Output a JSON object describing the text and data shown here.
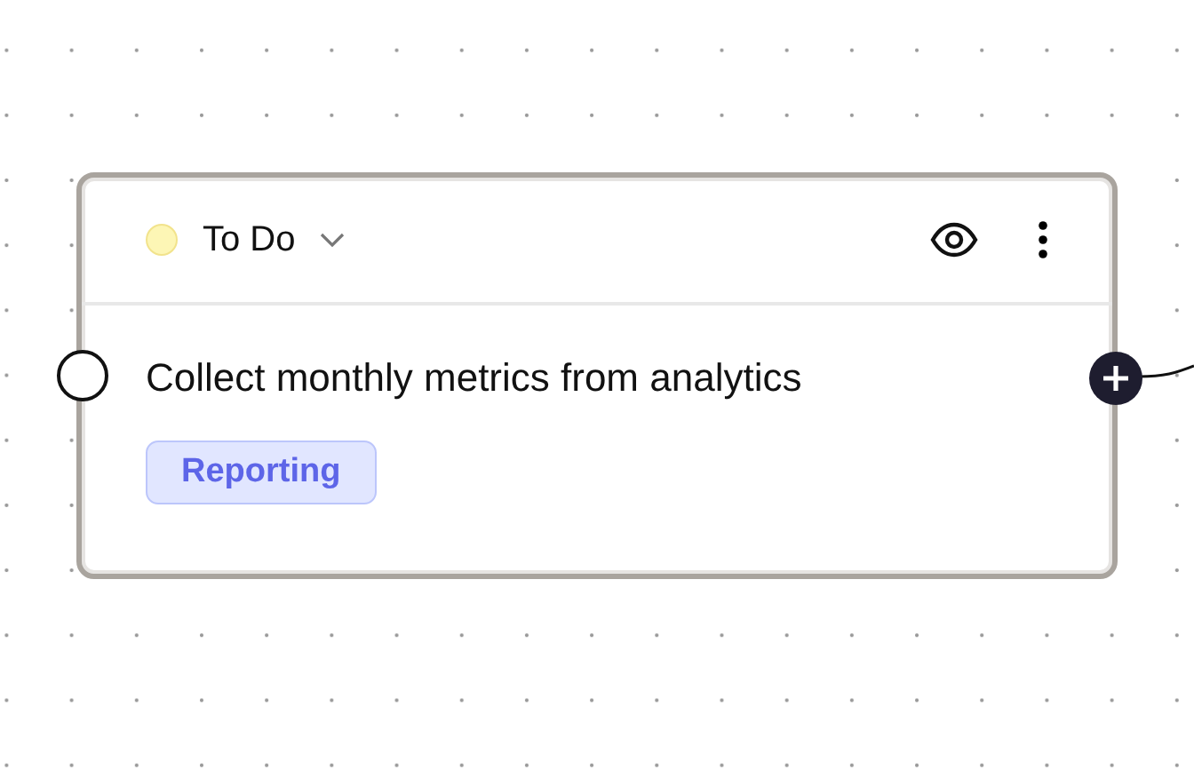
{
  "card": {
    "status": {
      "label": "To Do",
      "color": "#fdf6b5"
    },
    "title": "Collect monthly metrics from analytics",
    "tags": [
      {
        "label": "Reporting"
      }
    ]
  }
}
